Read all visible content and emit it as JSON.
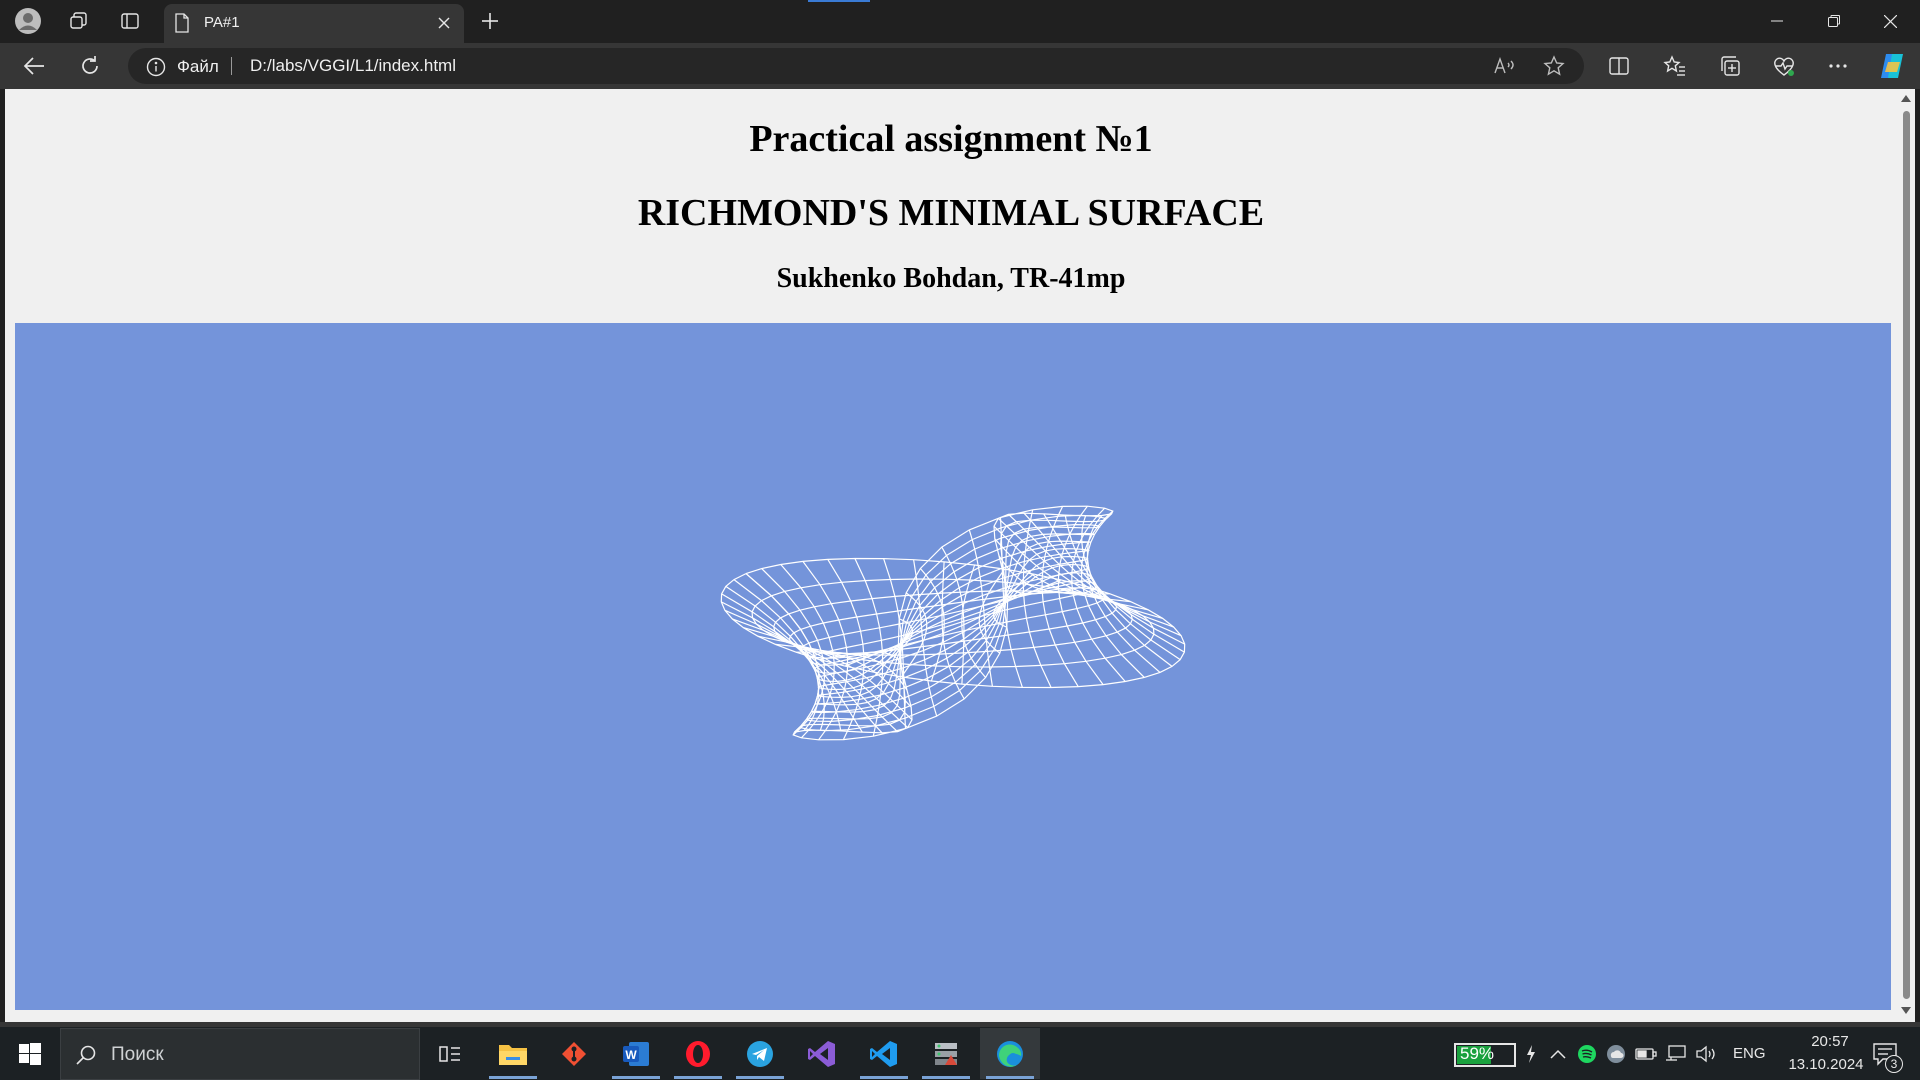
{
  "browser": {
    "tab_title": "PA#1",
    "address_scheme_label": "Файл",
    "address_url": "D:/labs/VGGI/L1/index.html"
  },
  "page": {
    "title": "Practical assignment №1",
    "subtitle": "RICHMOND'S MINIMAL SURFACE",
    "author": "Sukhenko Bohdan, TR-41mp",
    "canvas_background": "#7494da",
    "wireframe_color": "#ffffff"
  },
  "taskbar": {
    "search_placeholder": "Поиск",
    "battery_percent": "59%",
    "language": "ENG",
    "time": "20:57",
    "date": "13.10.2024",
    "notification_count": "3",
    "apps": [
      "task-view",
      "file-explorer",
      "git-extensions",
      "word",
      "opera",
      "telegram",
      "visual-studio",
      "vscode",
      "server-app",
      "edge"
    ]
  },
  "colors": {
    "titlebar": "#202020",
    "toolbar": "#363636",
    "page_bg": "#f0f0f0",
    "taskbar": "#1c2124",
    "accent": "#3a7bd5"
  }
}
